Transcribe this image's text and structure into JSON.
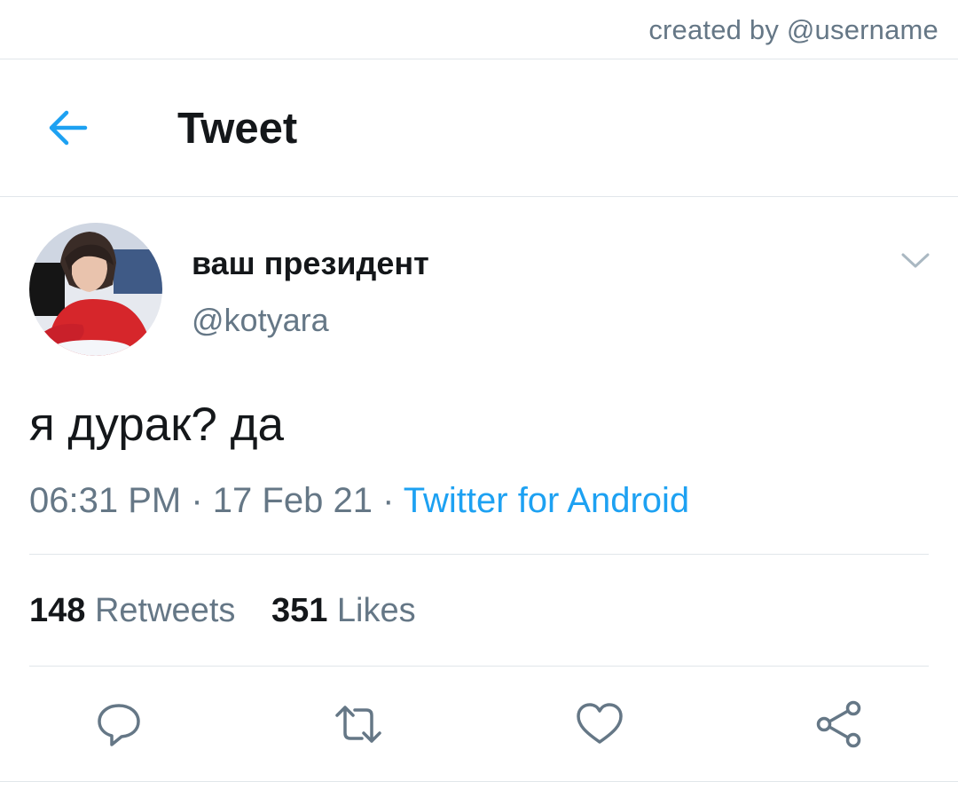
{
  "credit": "created by @username",
  "header": {
    "title": "Tweet",
    "back_icon": "arrow-left-icon"
  },
  "tweet": {
    "author_name": "ваш президент",
    "author_handle": "@kotyara",
    "text": "я дурак? да",
    "time": "06:31 PM",
    "separator": "·",
    "date": "17 Feb 21",
    "source": "Twitter for Android"
  },
  "stats": {
    "retweets_count": "148",
    "retweets_label": "Retweets",
    "likes_count": "351",
    "likes_label": "Likes"
  },
  "actions": {
    "reply_icon": "comment-icon",
    "retweet_icon": "retweet-icon",
    "like_icon": "heart-icon",
    "share_icon": "share-icon"
  },
  "colors": {
    "accent": "#1da1f2",
    "secondary_text": "#657786",
    "primary_text": "#14171a",
    "divider": "#e1e6ea"
  }
}
